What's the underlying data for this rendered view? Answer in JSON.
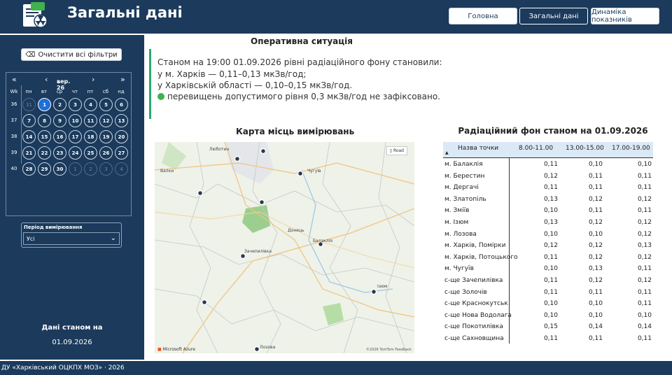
{
  "header": {
    "title": "Загальні дані",
    "nav": [
      "Головна",
      "Загальні дані",
      "Динаміка показників"
    ]
  },
  "sidebar": {
    "clear_filters": "Очистити всі фільтри",
    "calendar": {
      "prev_year": "«",
      "prev_month": "‹",
      "month_label": "вер. 26",
      "next_month": "›",
      "next_year": "»",
      "weekday_headers": [
        "Wk",
        "пн",
        "вт",
        "ср",
        "чт",
        "пт",
        "сб",
        "нд"
      ],
      "weeks": [
        {
          "wk": "36",
          "days": [
            "31",
            "1",
            "2",
            "3",
            "4",
            "5",
            "6"
          ]
        },
        {
          "wk": "37",
          "days": [
            "7",
            "8",
            "9",
            "10",
            "11",
            "12",
            "13"
          ]
        },
        {
          "wk": "38",
          "days": [
            "14",
            "15",
            "16",
            "17",
            "18",
            "19",
            "20"
          ]
        },
        {
          "wk": "39",
          "days": [
            "21",
            "22",
            "23",
            "24",
            "25",
            "26",
            "27"
          ]
        },
        {
          "wk": "40",
          "days": [
            "28",
            "29",
            "30",
            "1",
            "2",
            "3",
            "4"
          ]
        }
      ],
      "selected_day": "1"
    },
    "period": {
      "label": "Період вимірювання",
      "value": "Усі"
    },
    "data_as_of_label": "Дані станом на",
    "data_as_of_date": "01.09.2026"
  },
  "situation": {
    "title": "Оперативна ситуація",
    "lines": [
      "Станом на 19:00 01.09.2026 рівні радіаційного фону становили:",
      "у м. Харків — 0,11–0,13 мкЗв/год;",
      "у Харківській області — 0,10–0,15 мкЗв/год.",
      "перевищень допустимого рівня 0,3 мкЗв/год не зафіксовано."
    ]
  },
  "map": {
    "title": "Карта місць вимірювань",
    "road_button": "Road",
    "labels": [
      "Люботин",
      "Валки",
      "Чугуїв",
      "Донець",
      "Балаклія",
      "Зачепилівка",
      "Ізюм",
      "Лозова"
    ],
    "provider": "Microsoft Azure",
    "copyright": "©2026 TomTom Feedback"
  },
  "table": {
    "title": "Радіаційний фон станом на 01.09.2026",
    "columns": [
      "Назва точки",
      "8.00-11.00",
      "13.00-15.00",
      "17.00-19.00"
    ],
    "rows": [
      [
        "м. Балаклія",
        "0,11",
        "0,10",
        "0,10"
      ],
      [
        "м. Берестин",
        "0,12",
        "0,11",
        "0,11"
      ],
      [
        "м. Дергачі",
        "0,11",
        "0,11",
        "0,11"
      ],
      [
        "м. Златопіль",
        "0,13",
        "0,12",
        "0,12"
      ],
      [
        "м. Зміїв",
        "0,10",
        "0,11",
        "0,11"
      ],
      [
        "м. Ізюм",
        "0,13",
        "0,12",
        "0,12"
      ],
      [
        "м. Лозова",
        "0,10",
        "0,10",
        "0,12"
      ],
      [
        "м. Харків, Помірки",
        "0,12",
        "0,12",
        "0,13"
      ],
      [
        "м. Харків, Потоцького",
        "0,11",
        "0,12",
        "0,12"
      ],
      [
        "м. Чугуїв",
        "0,10",
        "0,13",
        "0,11"
      ],
      [
        "с-ще Зачепилівка",
        "0,11",
        "0,12",
        "0,12"
      ],
      [
        "с-ще Золочів",
        "0,11",
        "0,11",
        "0,11"
      ],
      [
        "с-ще Краснокутськ",
        "0,10",
        "0,10",
        "0,11"
      ],
      [
        "с-ще Нова Водолага",
        "0,10",
        "0,10",
        "0,10"
      ],
      [
        "с-ще Покотилівка",
        "0,15",
        "0,14",
        "0,14"
      ],
      [
        "с-ще Сахновщина",
        "0,11",
        "0,11",
        "0,11"
      ]
    ]
  },
  "footer": {
    "text": "ДУ «Харківський ОЦКПХ МОЗ» · 2026"
  }
}
